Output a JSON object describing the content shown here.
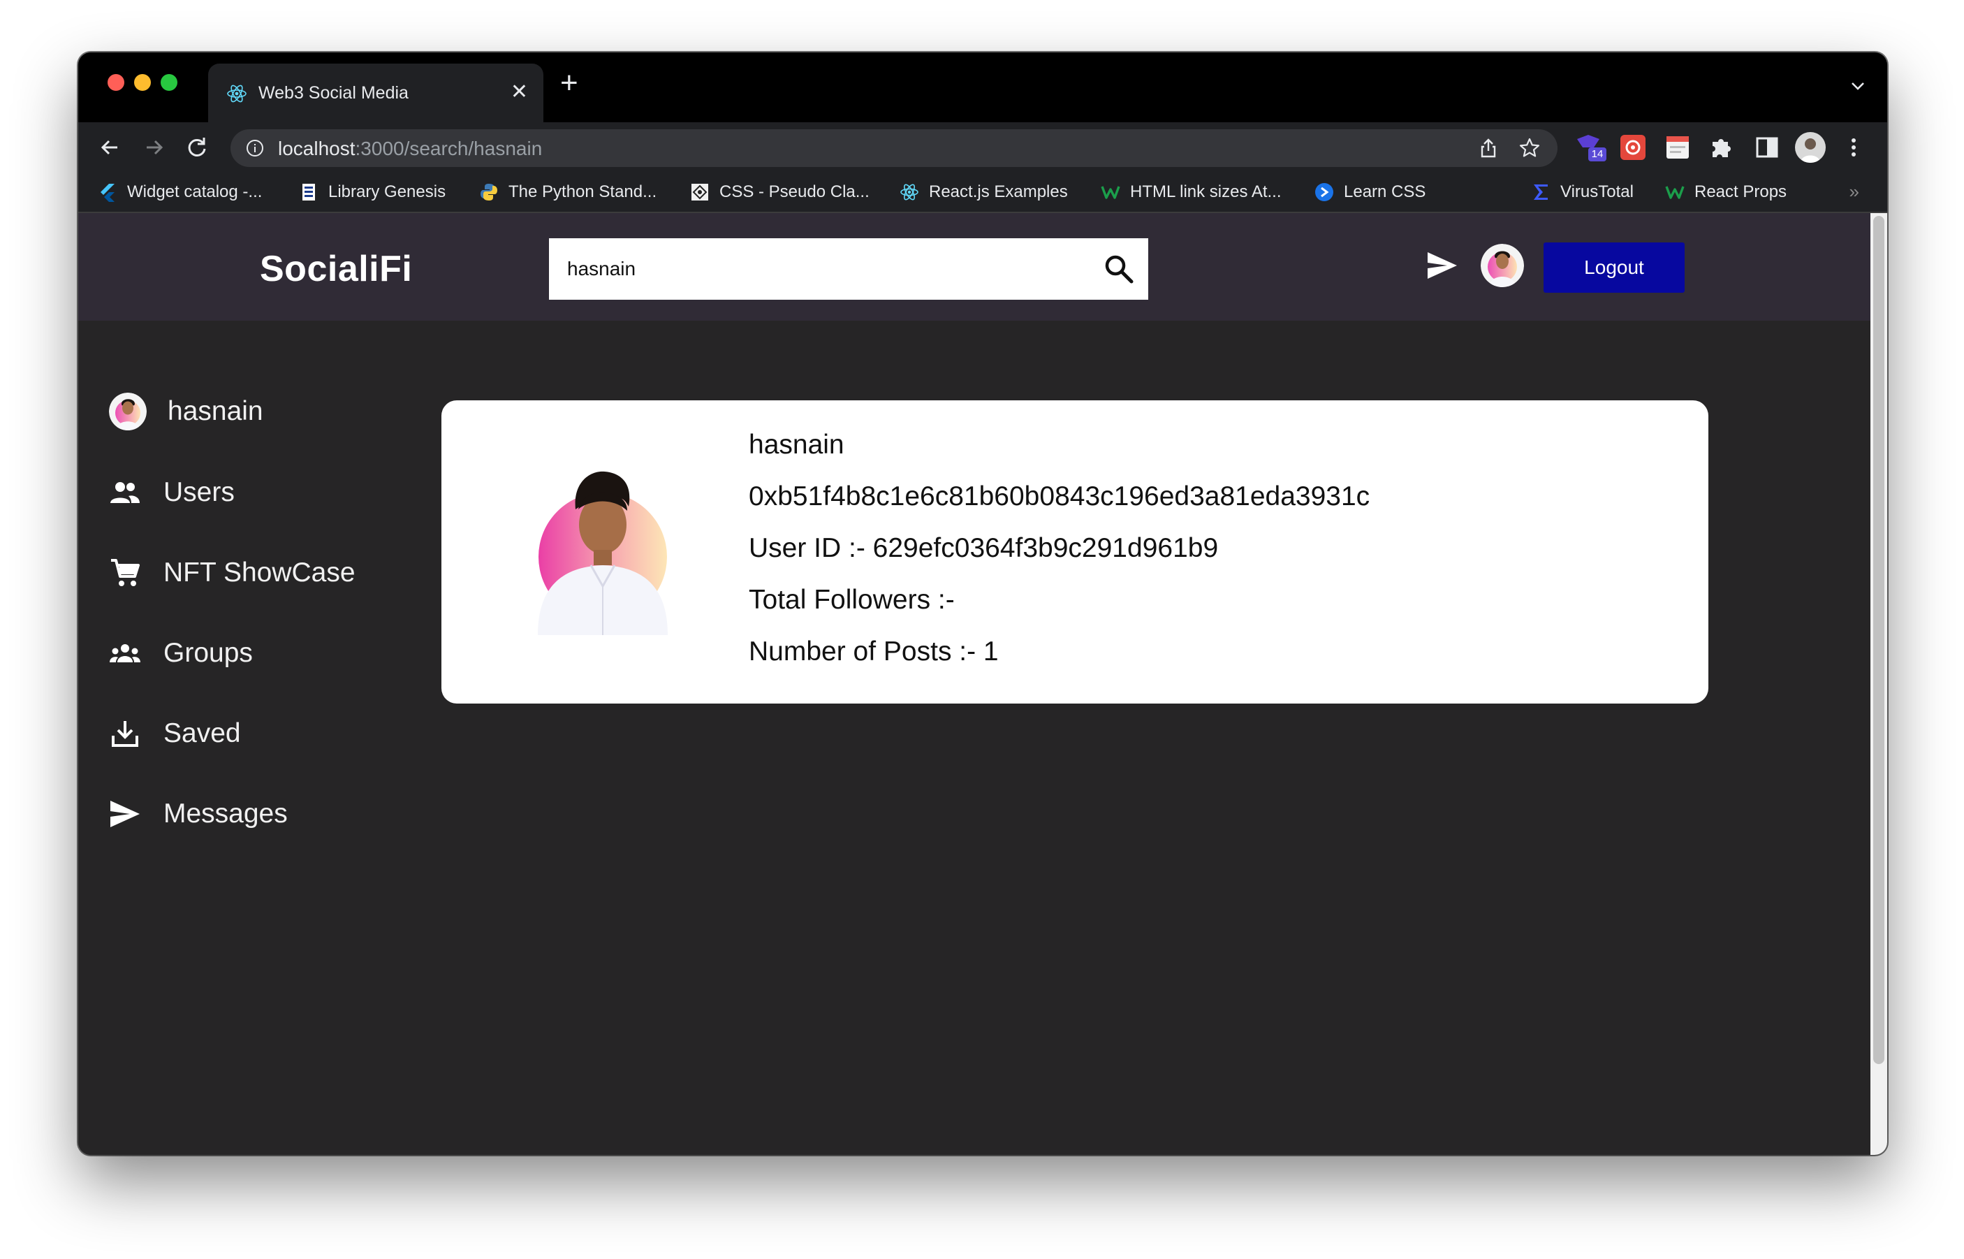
{
  "browser": {
    "tab": {
      "title": "Web3 Social Media"
    },
    "address": {
      "host": "localhost",
      "path": ":3000/search/hasnain"
    },
    "extension_badge": "14",
    "bookmarks": [
      {
        "label": "Widget catalog -...",
        "icon": "flutter-icon"
      },
      {
        "label": "Library Genesis",
        "icon": "book-icon"
      },
      {
        "label": "The Python Stand...",
        "icon": "python-icon"
      },
      {
        "label": "CSS - Pseudo Cla...",
        "icon": "css-icon"
      },
      {
        "label": "React.js Examples",
        "icon": "react-icon"
      },
      {
        "label": "HTML link sizes At...",
        "icon": "w-icon"
      },
      {
        "label": "Learn CSS",
        "icon": "arrow-circle-icon"
      },
      {
        "label": "VirusTotal",
        "icon": "sigma-icon"
      },
      {
        "label": "React Props",
        "icon": "w-icon"
      }
    ],
    "bookmarks_more": "»"
  },
  "app": {
    "logo": "SocialiFi",
    "search": {
      "value": "hasnain"
    },
    "logout_label": "Logout",
    "accent": "#07089f",
    "sidebar": {
      "user": "hasnain",
      "items": [
        {
          "label": "Users",
          "icon": "people-icon"
        },
        {
          "label": "NFT ShowCase",
          "icon": "cart-icon"
        },
        {
          "label": "Groups",
          "icon": "groups-icon"
        },
        {
          "label": "Saved",
          "icon": "download-icon"
        },
        {
          "label": "Messages",
          "icon": "send-icon"
        }
      ]
    },
    "result": {
      "username": "hasnain",
      "address": "0xb51f4b8c1e6c81b60b0843c196ed3a81eda3931c",
      "user_id": "User ID :- 629efc0364f3b9c291d961b9",
      "followers": "Total Followers :-",
      "posts": "Number of Posts :- 1"
    }
  }
}
